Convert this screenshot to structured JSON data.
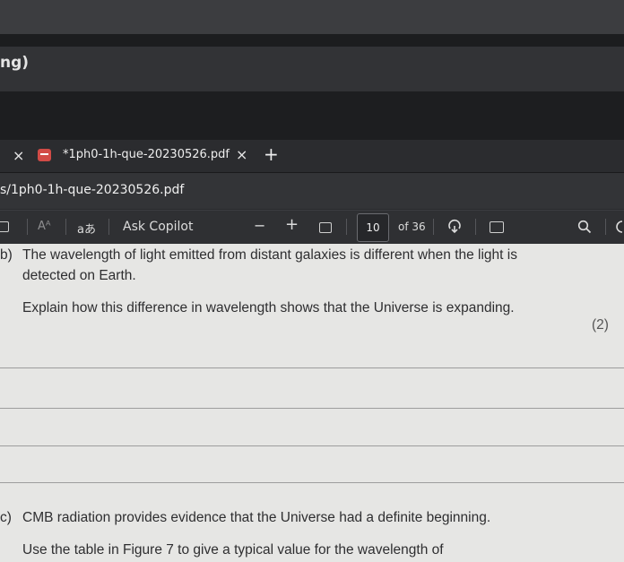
{
  "window": {
    "title_fragment": "ng)"
  },
  "tab": {
    "close_left": "×",
    "title": "*1ph0-1h-que-20230526.pdf",
    "close": "×",
    "new_tab": "+"
  },
  "address": {
    "text": "s/1ph0-1h-que-20230526.pdf"
  },
  "toolbar": {
    "read_aloud_label": "Aᴬ",
    "translate_label": "aあ",
    "copilot_label": "Ask Copilot",
    "zoom_out": "−",
    "zoom_in": "+",
    "page_number": "10",
    "page_of": "of 36"
  },
  "document": {
    "part_b_letter": "b)",
    "part_b_line1": "The wavelength of light emitted from distant galaxies is different when the light is",
    "part_b_line2": "detected on Earth.",
    "part_b_instruction": "Explain how this difference in wavelength shows that the Universe is expanding.",
    "part_b_marks": "(2)",
    "part_c_letter": "c)",
    "part_c_line1": "CMB radiation provides evidence that the Universe had a definite beginning.",
    "part_c_line2": "Use the table in Figure 7 to give a typical value for the wavelength of"
  },
  "colors": {
    "pdf_icon": "#d24b46",
    "page_bg": "#e6e6e4",
    "toolbar_bg": "#2f3033"
  }
}
